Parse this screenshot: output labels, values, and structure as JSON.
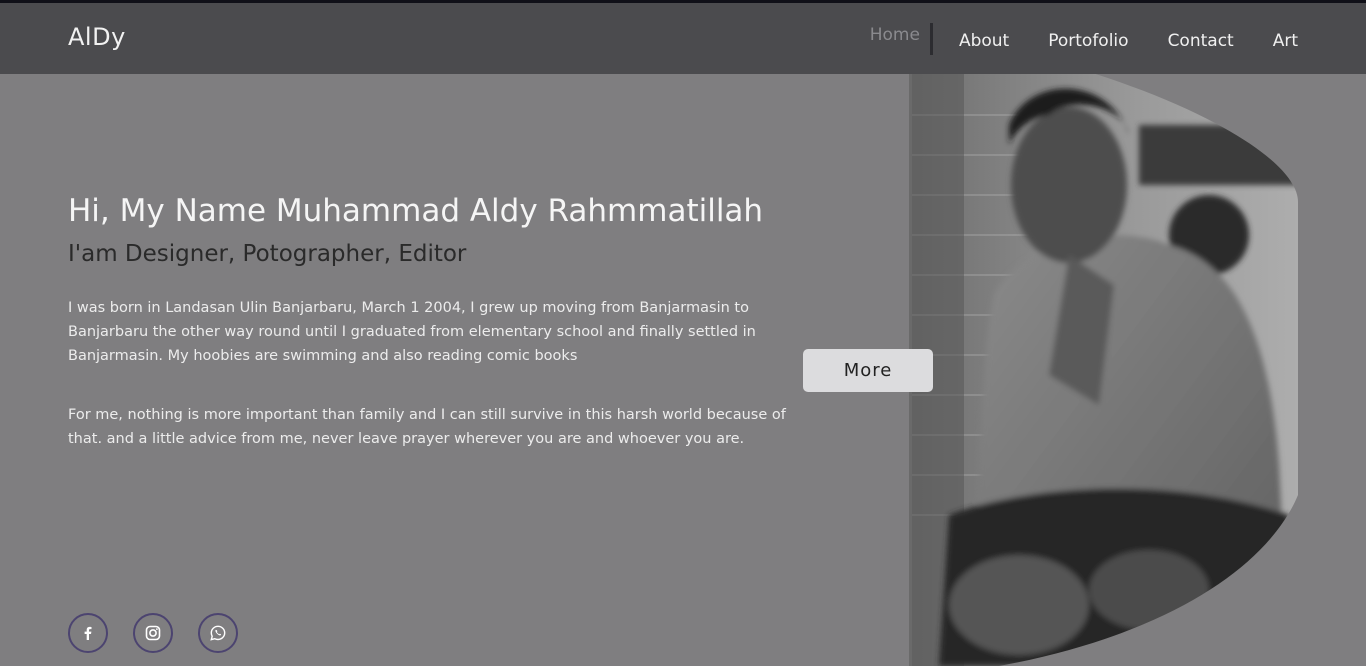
{
  "header": {
    "logo": "AlDy",
    "nav": [
      {
        "label": "Home",
        "active": true
      },
      {
        "label": "About"
      },
      {
        "label": "Portofolio"
      },
      {
        "label": "Contact"
      },
      {
        "label": "Art"
      }
    ]
  },
  "hero": {
    "headline": "Hi, My Name Muhammad Aldy Rahmmatillah",
    "subheadline": "I'am Designer, Potographer, Editor",
    "paragraph1": "I was born in Landasan Ulin Banjarbaru, March 1 2004, I grew up moving from Banjarmasin to Banjarbaru the other way round until I graduated from elementary school and finally settled in Banjarmasin. My hoobies are swimming and also reading comic books",
    "paragraph2": "For me, nothing is more important than family and I can still survive in this harsh world because of that. and a little advice from me, never leave prayer wherever you are and whoever you are.",
    "more_button": "More"
  },
  "socials": [
    {
      "icon": "facebook-icon"
    },
    {
      "icon": "instagram-icon"
    },
    {
      "icon": "whatsapp-icon"
    }
  ],
  "colors": {
    "background": "#7f7e80",
    "navbar": "#4b4b4e",
    "social_border": "#4c4470",
    "button": "#dcdcde"
  }
}
